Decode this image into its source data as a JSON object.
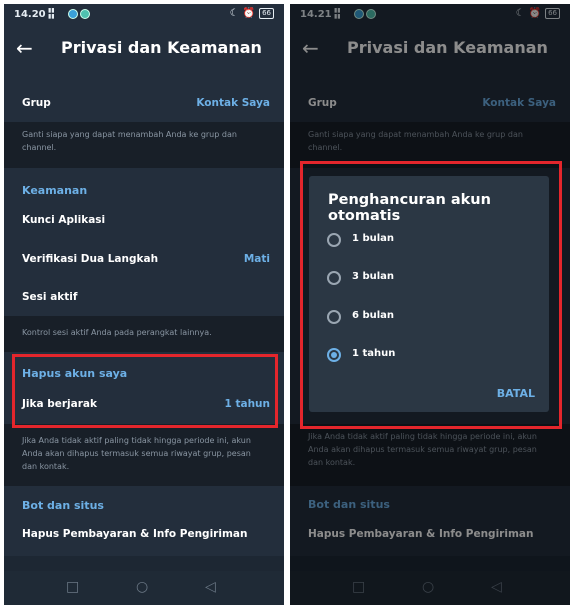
{
  "left": {
    "status": {
      "time": "14.20",
      "battery": "66"
    },
    "title": "Privasi dan Keamanan",
    "partial_row_value": "",
    "group": {
      "label": "Grup",
      "value": "Kontak Saya",
      "note": "Ganti siapa yang dapat menambah Anda ke grup dan channel."
    },
    "security": {
      "header": "Keamanan",
      "app_lock": "Kunci Aplikasi",
      "two_step": {
        "label": "Verifikasi Dua Langkah",
        "value": "Mati"
      },
      "sessions": "Sesi aktif",
      "sessions_note": "Kontrol sesi aktif Anda pada perangkat lainnya."
    },
    "delete": {
      "header": "Hapus akun saya",
      "if_away": {
        "label": "Jika berjarak",
        "value": "1 tahun"
      },
      "note": "Jika Anda tidak aktif paling tidak hingga periode ini, akun Anda akan dihapus termasuk semua riwayat grup, pesan dan kontak."
    },
    "bots": {
      "header": "Bot dan situs",
      "item": "Hapus Pembayaran & Info Pengiriman"
    }
  },
  "right": {
    "status": {
      "time": "14.21",
      "battery": "66"
    },
    "title": "Privasi dan Keamanan",
    "group": {
      "label": "Grup",
      "value": "Kontak Saya",
      "note": "Ganti siapa yang dapat menambah Anda ke grup dan channel."
    },
    "delete_note": "Jika Anda tidak aktif paling tidak hingga periode ini, akun Anda akan dihapus termasuk semua riwayat grup, pesan dan kontak.",
    "bots": {
      "header": "Bot dan situs",
      "item": "Hapus Pembayaran & Info Pengiriman"
    },
    "dialog": {
      "title": "Penghancuran akun otomatis",
      "options": [
        "1 bulan",
        "3 bulan",
        "6 bulan",
        "1 tahun"
      ],
      "selected": "1 tahun",
      "cancel": "BATAL"
    }
  },
  "colors": {
    "accent": "#6db0e6",
    "highlight_box": "#e4262c",
    "background": "#1d2733"
  },
  "icons": {
    "back": "arrow-left-icon",
    "nav_recent": "square-icon",
    "nav_home": "circle-icon",
    "nav_back": "triangle-left-icon"
  }
}
